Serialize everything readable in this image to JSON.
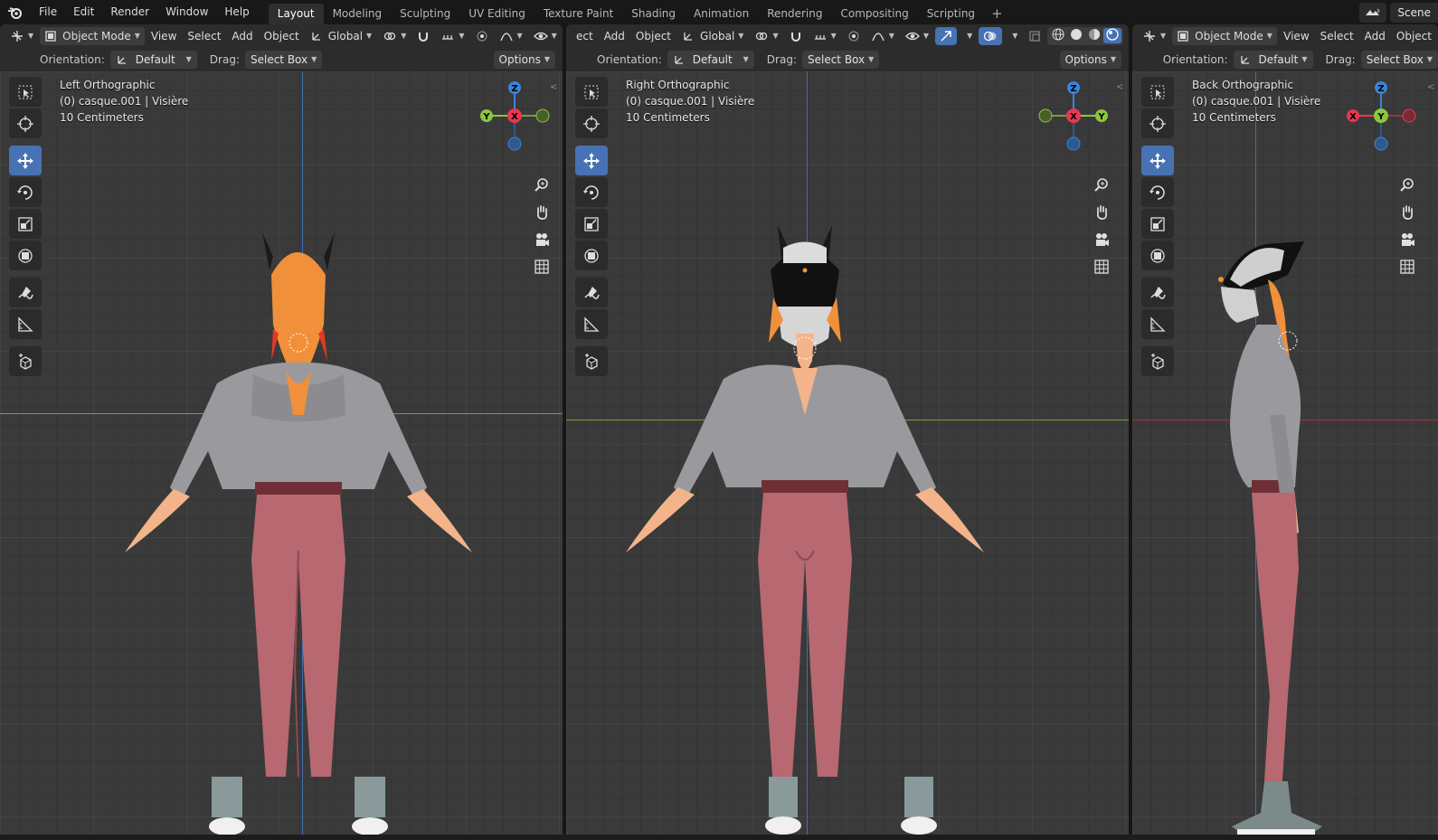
{
  "app": {
    "menus": [
      "File",
      "Edit",
      "Render",
      "Window",
      "Help"
    ],
    "workspaces": [
      "Layout",
      "Modeling",
      "Sculpting",
      "UV Editing",
      "Texture Paint",
      "Shading",
      "Animation",
      "Rendering",
      "Compositing",
      "Scripting"
    ],
    "active_workspace": "Layout",
    "add_workspace": "+",
    "scene_label": "Scene"
  },
  "header": {
    "mode": "Object Mode",
    "menus": [
      "View",
      "Select",
      "Add",
      "Object"
    ],
    "middle_menus": [
      "ect",
      "Add",
      "Object"
    ],
    "transform_orientation": "Global",
    "orientation_label": "Orientation:",
    "orientation_value": "Default",
    "drag_label": "Drag:",
    "drag_value": "Select Box",
    "options_label": "Options"
  },
  "viewports": [
    {
      "view_name": "Left Orthographic",
      "object_info": "(0) casque.001 | Visière",
      "scale": "10 Centimeters",
      "axis_left": "Y",
      "axis_center": "X",
      "axis_right": "",
      "axis_top": "Z"
    },
    {
      "view_name": "Right Orthographic",
      "object_info": "(0) casque.001 | Visière",
      "scale": "10 Centimeters",
      "axis_left": "",
      "axis_center": "X",
      "axis_right": "Y",
      "axis_top": "Z"
    },
    {
      "view_name": "Back Orthographic",
      "object_info": "(0) casque.001 | Visière",
      "scale": "10 Centimeters",
      "axis_left": "X",
      "axis_center": "Y",
      "axis_right": "",
      "axis_top": "Z"
    }
  ],
  "colors": {
    "axis_x": "#e8384f",
    "axis_y": "#8cc63f",
    "axis_z": "#3a84d8",
    "active_tool": "#4772b3",
    "sweater": "#9a9a9e",
    "leggings": "#b76870",
    "hair": "#f0903a"
  }
}
